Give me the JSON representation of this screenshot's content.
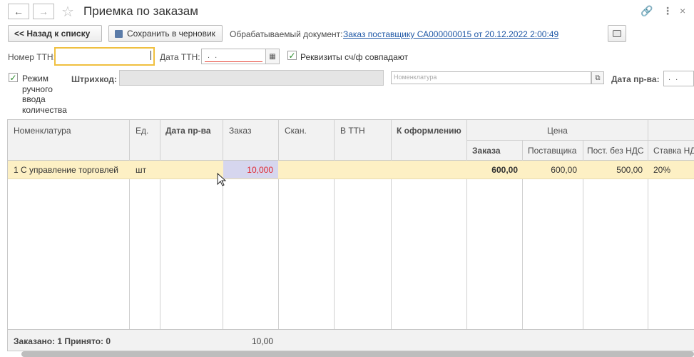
{
  "title": "Приемка по заказам",
  "toolbar": {
    "back_label": "<< Назад к списку",
    "save_draft_label": "Сохранить в черновик",
    "doc_label": "Обрабатываемый документ:",
    "doc_link": "Заказ поставщику СА000000015 от 20.12.2022 2:00:49"
  },
  "form": {
    "ttn_number_label": "Номер ТТН:",
    "ttn_number_value": "",
    "ttn_date_label": "Дата ТТН:",
    "ttn_date_placeholder": ". .",
    "invoice_match_label": "Реквизиты сч/ф совпадают",
    "manual_mode_label": "Режим ручного ввода количества",
    "barcode_label": "Штрихкод:",
    "nomenclature_placeholder": "Номенклатура",
    "production_date_label": "Дата пр-ва:"
  },
  "table": {
    "headers": {
      "nomenclature": "Номенклатура",
      "unit": "Ед.",
      "production_date": "Дата пр-ва",
      "order": "Заказ",
      "scan": "Скан.",
      "in_ttn": "В ТТН",
      "to_process": "К оформлению",
      "price": "Цена",
      "price_order": "Заказа",
      "price_supplier": "Поставщика",
      "price_no_vat": "Пост. без НДС",
      "vat_rate": "Ставка НД"
    },
    "rows": [
      {
        "nomenclature": "1 С управление торговлей",
        "unit": "шт",
        "production_date": "",
        "order": "10,000",
        "scan": "",
        "in_ttn": "",
        "to_process": "",
        "price_order": "600,00",
        "price_supplier": "600,00",
        "price_no_vat": "500,00",
        "vat_rate": "20%"
      }
    ],
    "footer": {
      "summary": "Заказано: 1 Принято: 0",
      "order_total": "10,00"
    }
  },
  "icons": {
    "back": "arrow-left",
    "forward": "arrow-right",
    "favorite": "star",
    "link": "link",
    "more": "vertical-dots",
    "save": "floppy-disk",
    "calendar": "calendar",
    "open": "open-window",
    "camera": "camera"
  }
}
